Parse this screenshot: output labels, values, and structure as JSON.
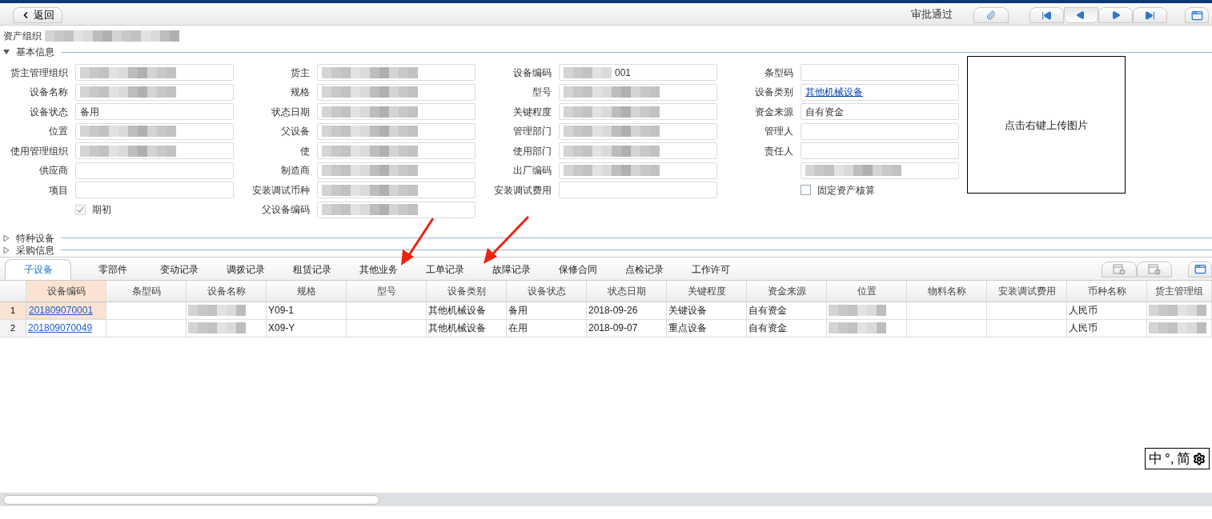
{
  "toolbar": {
    "back": "返回",
    "status": "审批通过"
  },
  "org": {
    "label": "资产组织",
    "redacted": true
  },
  "sections": [
    {
      "title": "基本信息",
      "expanded": true
    },
    {
      "title": "特种设备",
      "expanded": false
    },
    {
      "title": "采购信息",
      "expanded": false
    }
  ],
  "form": {
    "rows": [
      [
        {
          "kind": "field",
          "label": "货主管理组织",
          "redacted": true
        },
        {
          "kind": "field",
          "label": "货主",
          "redacted": true
        },
        {
          "kind": "field",
          "label": "设备编码",
          "value": "001",
          "redacted": true
        },
        {
          "kind": "field",
          "label": "条型码"
        }
      ],
      [
        {
          "kind": "field",
          "label": "设备名称",
          "redacted": true
        },
        {
          "kind": "field",
          "label": "规格",
          "redacted": true
        },
        {
          "kind": "field",
          "label": "型号",
          "redacted": true
        },
        {
          "kind": "link",
          "label": "设备类别",
          "value": "其他机械设备"
        }
      ],
      [
        {
          "kind": "field",
          "label": "设备状态",
          "value": "备用"
        },
        {
          "kind": "field",
          "label": "状态日期",
          "redacted": true
        },
        {
          "kind": "field",
          "label": "关键程度",
          "redacted": true
        },
        {
          "kind": "field",
          "label": "资金来源",
          "value": "自有资金"
        }
      ],
      [
        {
          "kind": "field",
          "label": "位置",
          "redacted": true
        },
        {
          "kind": "field",
          "label": "父设备",
          "redacted": true
        },
        {
          "kind": "field",
          "label": "管理部门",
          "redacted": true
        },
        {
          "kind": "field",
          "label": "管理人"
        }
      ],
      [
        {
          "kind": "field",
          "label": "使用管理组织",
          "redacted": true
        },
        {
          "kind": "field",
          "label": "使",
          "redacted": true
        },
        {
          "kind": "field",
          "label": "使用部门",
          "redacted": true
        },
        {
          "kind": "field",
          "label": "责任人"
        }
      ],
      [
        {
          "kind": "field",
          "label": "供应商"
        },
        {
          "kind": "field",
          "label": "制造商",
          "redacted": true
        },
        {
          "kind": "field",
          "label": "出厂编码",
          "redacted": true
        },
        {
          "kind": "field",
          "redacted": true
        }
      ],
      [
        {
          "kind": "field",
          "label": "项目"
        },
        {
          "kind": "field",
          "label": "安装调试币种",
          "redacted": true
        },
        {
          "kind": "field",
          "label": "安装调试费用"
        },
        {
          "kind": "checkbox",
          "label": "固定资产核算",
          "checked": false,
          "disabled": false
        }
      ],
      [
        {
          "kind": "checkbox",
          "label": "期初",
          "checked": true,
          "disabled": true
        },
        {
          "kind": "field",
          "label": "父设备编码",
          "redacted": true
        },
        {
          "kind": "blank"
        },
        {
          "kind": "blank"
        }
      ]
    ]
  },
  "image_box": {
    "text": "点击右键上传图片"
  },
  "tabs": [
    {
      "label": "子设备",
      "selected": true
    },
    {
      "label": "零部件",
      "selected": false
    },
    {
      "label": "变动记录",
      "selected": false
    },
    {
      "label": "调拨记录",
      "selected": false
    },
    {
      "label": "租赁记录",
      "selected": false
    },
    {
      "label": "其他业务",
      "selected": false
    },
    {
      "label": "工单记录",
      "selected": false
    },
    {
      "label": "故障记录",
      "selected": false
    },
    {
      "label": "保修合同",
      "selected": false
    },
    {
      "label": "点检记录",
      "selected": false
    },
    {
      "label": "工作许可",
      "selected": false
    }
  ],
  "table": {
    "columns": [
      {
        "label": "设备编码",
        "selected": true
      },
      {
        "label": "条型码",
        "selected": false
      },
      {
        "label": "设备名称",
        "selected": false
      },
      {
        "label": "规格",
        "selected": false
      },
      {
        "label": "型号",
        "selected": false
      },
      {
        "label": "设备类别",
        "selected": false
      },
      {
        "label": "设备状态",
        "selected": false
      },
      {
        "label": "状态日期",
        "selected": false
      },
      {
        "label": "关键程度",
        "selected": false
      },
      {
        "label": "资金来源",
        "selected": false
      },
      {
        "label": "位置",
        "selected": false
      },
      {
        "label": "物料名称",
        "selected": false
      },
      {
        "label": "安装调试费用",
        "selected": false
      },
      {
        "label": "币种名称",
        "selected": false
      },
      {
        "label": "货主管理组",
        "selected": false
      }
    ],
    "rows": [
      {
        "number": "1",
        "selected": true,
        "cells": [
          {
            "kind": "link",
            "text": "201809070001"
          },
          {
            "kind": "empty"
          },
          {
            "kind": "redacted"
          },
          {
            "kind": "text",
            "text": "Y09-1"
          },
          {
            "kind": "empty"
          },
          {
            "kind": "text",
            "text": "其他机械设备"
          },
          {
            "kind": "text",
            "text": "备用"
          },
          {
            "kind": "text",
            "text": "2018-09-26"
          },
          {
            "kind": "text",
            "text": "关键设备"
          },
          {
            "kind": "text",
            "text": "自有资金"
          },
          {
            "kind": "redacted"
          },
          {
            "kind": "empty"
          },
          {
            "kind": "empty"
          },
          {
            "kind": "text",
            "text": "人民币"
          },
          {
            "kind": "redacted"
          }
        ]
      },
      {
        "number": "2",
        "selected": false,
        "cells": [
          {
            "kind": "link",
            "text": "201809070049"
          },
          {
            "kind": "empty"
          },
          {
            "kind": "redacted"
          },
          {
            "kind": "text",
            "text": "X09-Y"
          },
          {
            "kind": "empty"
          },
          {
            "kind": "text",
            "text": "其他机械设备"
          },
          {
            "kind": "text",
            "text": "在用"
          },
          {
            "kind": "text",
            "text": "2018-09-07"
          },
          {
            "kind": "text",
            "text": "重点设备"
          },
          {
            "kind": "text",
            "text": "自有资金"
          },
          {
            "kind": "redacted"
          },
          {
            "kind": "empty"
          },
          {
            "kind": "empty"
          },
          {
            "kind": "text",
            "text": "人民币"
          },
          {
            "kind": "redacted"
          }
        ]
      }
    ]
  },
  "ime": {
    "mode": "中",
    "punct": "°,",
    "script": "简"
  }
}
